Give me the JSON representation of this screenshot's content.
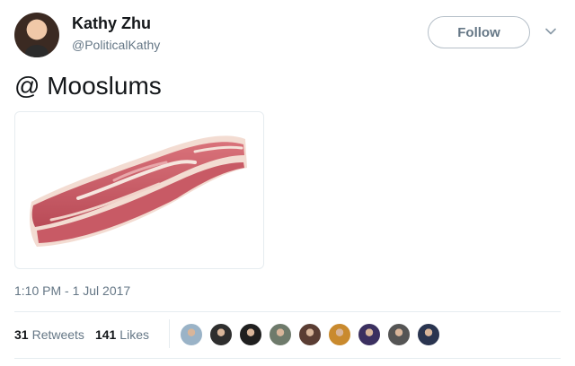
{
  "author": {
    "name": "Kathy Zhu",
    "handle": "@PoliticalKathy",
    "avatar_icon": "profile-photo"
  },
  "header": {
    "follow_label": "Follow",
    "menu_icon": "chevron-down-icon"
  },
  "tweet": {
    "text": "@ Mooslums",
    "media_icon": "bacon-image",
    "timestamp": "1:10 PM - 1 Jul 2017"
  },
  "stats": {
    "retweets_count": "31",
    "retweets_label": "Retweets",
    "likes_count": "141",
    "likes_label": "Likes"
  },
  "likers": [
    {
      "name": "liker-avatar-1",
      "color": "#9ab3c7"
    },
    {
      "name": "liker-avatar-2",
      "color": "#2e2e2e"
    },
    {
      "name": "liker-avatar-3",
      "color": "#1f1f1f"
    },
    {
      "name": "liker-avatar-4",
      "color": "#6e7a6b"
    },
    {
      "name": "liker-avatar-5",
      "color": "#5a3d33"
    },
    {
      "name": "liker-avatar-6",
      "color": "#c98a2e"
    },
    {
      "name": "liker-avatar-7",
      "color": "#3b3060"
    },
    {
      "name": "liker-avatar-8",
      "color": "#555555"
    },
    {
      "name": "liker-avatar-9",
      "color": "#2a3550"
    }
  ],
  "colors": {
    "text_primary": "#14171a",
    "text_secondary": "#657786",
    "border": "#e6ecf0"
  }
}
